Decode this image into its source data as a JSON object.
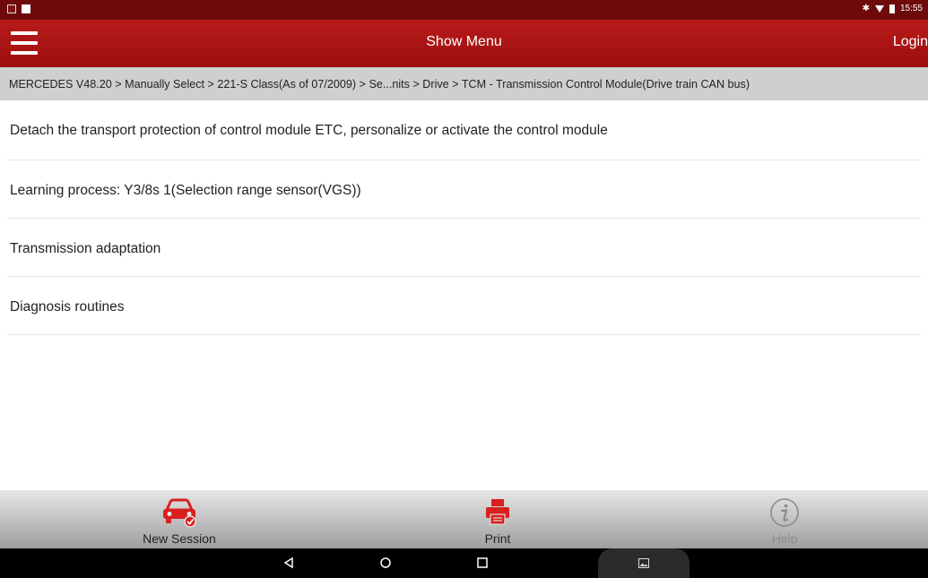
{
  "statusbar": {
    "time": "15:55",
    "bluetooth_glyph": "✱"
  },
  "header": {
    "title": "Show Menu",
    "login_label": "Login"
  },
  "breadcrumb": "MERCEDES V48.20 > Manually Select > 221-S Class(As of 07/2009) > Se...nits > Drive > TCM - Transmission Control Module(Drive train CAN bus)",
  "menu_items": [
    {
      "label": "Detach the transport protection of control module ETC, personalize or activate the control module"
    },
    {
      "label": "Learning process: Y3/8s 1(Selection range sensor(VGS))"
    },
    {
      "label": "Transmission adaptation"
    },
    {
      "label": "Diagnosis routines"
    }
  ],
  "toolbar": {
    "new_session": {
      "label": "New Session",
      "icon": "car-icon"
    },
    "print": {
      "label": "Print",
      "icon": "printer-icon"
    },
    "help": {
      "label": "Help",
      "icon": "info-icon"
    }
  },
  "colors": {
    "accent": "#b81a1a",
    "breadcrumb_bg": "#cfcfcf"
  }
}
